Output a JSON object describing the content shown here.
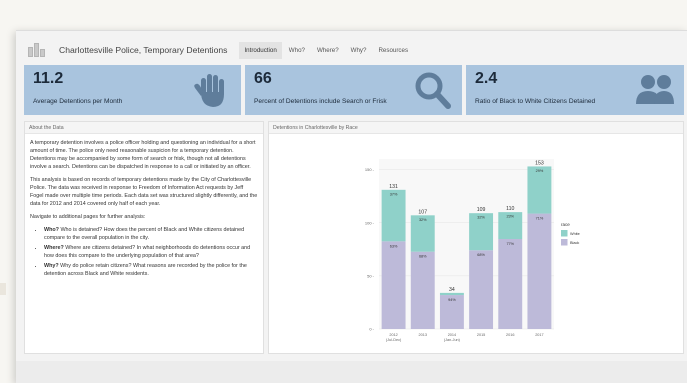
{
  "nav": {
    "title": "Charlottesville Police, Temporary Detentions",
    "tabs": [
      "Introduction",
      "Who?",
      "Where?",
      "Why?",
      "Resources"
    ],
    "active_tab": "Introduction"
  },
  "kpis": [
    {
      "value": "11.2",
      "label": "Average Detentions per Month",
      "icon": "hand-icon"
    },
    {
      "value": "66",
      "label": "Percent of Detentions include Search or Frisk",
      "icon": "magnifier-icon"
    },
    {
      "value": "2.4",
      "label": "Ratio of Black to White Citizens Detained",
      "icon": "people-icon"
    }
  ],
  "about": {
    "header": "About the Data",
    "p1": "A temporary detention involves a police officer holding and questioning an individual for a short amount of time. The police only need reasonable suspicion for a temporary detention. Detentions may be accompanied by some form of search or frisk, though not all detentions involve a search. Detentions can be dispatched in response to a call or initiated by an officer.",
    "p2": "This analysis is based on records of temporary detentions made by the City of Charlottesville Police. The data was received in response to Freedom of Information Act requests by Jeff Fogel made over multiple time periods. Each data set was structured slightly differently, and the data for 2012 and 2014 covered only half of each year.",
    "p3": "Navigate to additional pages for further analysis:",
    "bullets": [
      {
        "bold": "Who?",
        "text": " Who is detained? How does the percent of Black and White citizens detained compare to the overall population in the city."
      },
      {
        "bold": "Where?",
        "text": " Where are citizens detained? In what neighborhoods do detentions occur and how does this compare to the underlying population of that area?"
      },
      {
        "bold": "Why?",
        "text": " Why do police retain citizens? What reasons are recorded by the police for the detention across Black and White residents."
      }
    ]
  },
  "chart_data": {
    "type": "bar",
    "title": "Detentions in Charlottesville by Race",
    "categories": [
      "2012\n(Jul-Dec)",
      "2013",
      "2014\n(Jan-Jun)",
      "2015",
      "2016",
      "2017"
    ],
    "totals": [
      131,
      107,
      34,
      109,
      110,
      153
    ],
    "series": [
      {
        "name": "White",
        "percent_labels": [
          "37%",
          "32%",
          "",
          "32%",
          "23%",
          "29%"
        ],
        "color": "#8fd1c9"
      },
      {
        "name": "Black",
        "percent_labels": [
          "63%",
          "68%",
          "94%",
          "68%",
          "77%",
          "71%"
        ],
        "color": "#bdbad9"
      }
    ],
    "black_share": [
      0.63,
      0.68,
      0.94,
      0.68,
      0.77,
      0.71
    ],
    "yticks": [
      0,
      50,
      100,
      150
    ],
    "ylim": [
      0,
      160
    ],
    "legend_title": "race",
    "legend_position": "right",
    "grid": true
  }
}
